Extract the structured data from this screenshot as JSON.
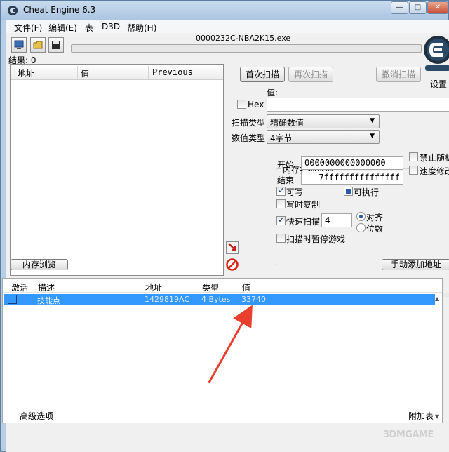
{
  "window": {
    "title": "Cheat Engine 6.3",
    "min": "—",
    "max": "□",
    "close": "✕"
  },
  "menu": [
    "文件(F)",
    "编辑(E)",
    "表",
    "D3D",
    "帮助(H)"
  ],
  "process_name": "0000232C-NBA2K15.exe",
  "settings_label": "设置",
  "results": {
    "label": "结果:",
    "count": "0"
  },
  "result_list": {
    "columns": [
      "地址",
      "值",
      "Previous"
    ]
  },
  "scan": {
    "first_scan": "首次扫描",
    "next_scan": "再次扫描",
    "undo_scan": "撤消扫描",
    "value_label": "值:",
    "hex_label": "Hex",
    "scan_type_label": "扫描类型",
    "scan_type_value": "精确数值",
    "value_type_label": "数值类型",
    "value_type_value": "4字节"
  },
  "memory_options": {
    "title": "内存扫描选项",
    "start_label": "开始",
    "start_value": "0000000000000000",
    "end_label": "结束",
    "end_value": "7fffffffffffffff",
    "writable": "可写",
    "executable": "可执行",
    "copy_on_write": "写时复制",
    "fast_scan": "快速扫描",
    "fast_scan_value": "4",
    "align": "对齐",
    "last_digits": "位数",
    "pause_game": "扫描时暂停游戏"
  },
  "extra_options": {
    "random_off": "禁止随机",
    "speedhack": "速度修改"
  },
  "buttons": {
    "memory_view": "内存浏览",
    "add_address": "手动添加地址"
  },
  "address_list": {
    "columns": [
      "激活",
      "描述",
      "地址",
      "类型",
      "值"
    ],
    "rows": [
      {
        "description": "技能点",
        "address": "1429819AC",
        "type": "4 Bytes",
        "value": "33740"
      }
    ]
  },
  "footer": {
    "advanced": "高级选项",
    "table_extras": "附加表"
  },
  "watermark": "3DMGAME",
  "colors": {
    "selection": "#3399ff",
    "arrow": "#e8402c"
  }
}
